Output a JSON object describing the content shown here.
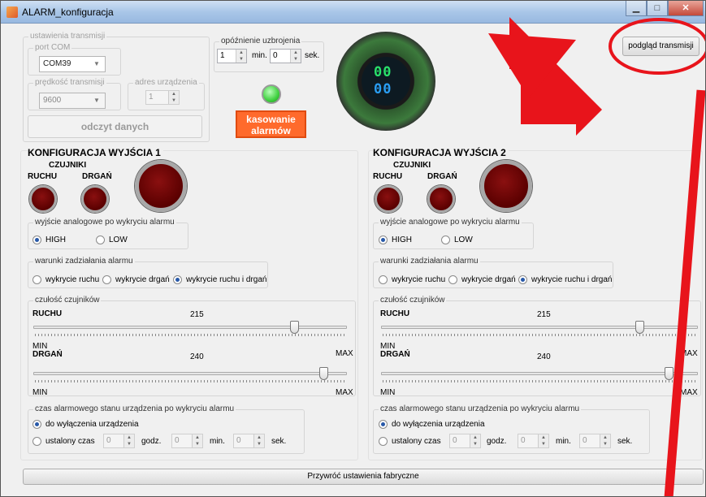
{
  "window": {
    "title": "ALARM_konfiguracja"
  },
  "transmission": {
    "group_label": "ustawienia transmisji",
    "port_label": "port COM",
    "port_value": "COM39",
    "speed_label": "prędkość transmisji",
    "speed_value": "9600",
    "address_label": "adres urządzenia",
    "address_value": "1",
    "read_button": "odczyt danych"
  },
  "arming_delay": {
    "label": "opóźnienie uzbrojenia",
    "minutes": "1",
    "min_unit": "min.",
    "seconds": "0",
    "sec_unit": "sek."
  },
  "reset_button": {
    "line1": "kasowanie",
    "line2": "alarmów"
  },
  "display": {
    "digits": "00"
  },
  "preview_button": "podgląd transmisji",
  "outputs": [
    {
      "title": "KONFIGURACJA WYJŚCIA 1",
      "sensors_label": "CZUJNIKI",
      "motion_label": "RUCHU",
      "vibration_label": "DRGAŃ",
      "analog_label": "wyjście analogowe po wykryciu alarmu",
      "high": "HIGH",
      "low": "LOW",
      "conditions_label": "warunki zadziałania alarmu",
      "cond_motion": "wykrycie ruchu",
      "cond_vibration": "wykrycie drgań",
      "cond_both": "wykrycie ruchu i drgań",
      "sensitivity_label": "czułość czujników",
      "motion_title": "RUCHU",
      "motion_value": "215",
      "vibration_title": "DRGAŃ",
      "vibration_value": "240",
      "min": "MIN",
      "max": "MAX",
      "alarm_time_label": "czas alarmowego stanu urządzenia po wykryciu alarmu",
      "until_off": "do wyłączenia urządzenia",
      "fixed_time": "ustalony czas",
      "hours_value": "0",
      "hours_unit": "godz.",
      "min_value": "0",
      "min_unit": "min.",
      "sec_value": "0",
      "sec_unit": "sek."
    },
    {
      "title": "KONFIGURACJA WYJŚCIA 2",
      "sensors_label": "CZUJNIKI",
      "motion_label": "RUCHU",
      "vibration_label": "DRGAŃ",
      "analog_label": "wyjście analogowe po wykryciu alarmu",
      "high": "HIGH",
      "low": "LOW",
      "conditions_label": "warunki zadziałania alarmu",
      "cond_motion": "wykrycie ruchu",
      "cond_vibration": "wykrycie drgań",
      "cond_both": "wykrycie ruchu i drgań",
      "sensitivity_label": "czułość czujników",
      "motion_title": "RUCHU",
      "motion_value": "215",
      "vibration_title": "DRGAŃ",
      "vibration_value": "240",
      "min": "MIN",
      "max": "MAX",
      "alarm_time_label": "czas alarmowego stanu urządzenia po wykryciu alarmu",
      "until_off": "do wyłączenia urządzenia",
      "fixed_time": "ustalony czas",
      "hours_value": "0",
      "hours_unit": "godz.",
      "min_value": "0",
      "min_unit": "min.",
      "sec_value": "0",
      "sec_unit": "sek."
    }
  ],
  "factory_reset_button": "Przywróć ustawienia fabryczne",
  "colors": {
    "annotation_red": "#e8141b",
    "led_green": "#3fd03f",
    "reset_orange": "#ff6a2c"
  }
}
